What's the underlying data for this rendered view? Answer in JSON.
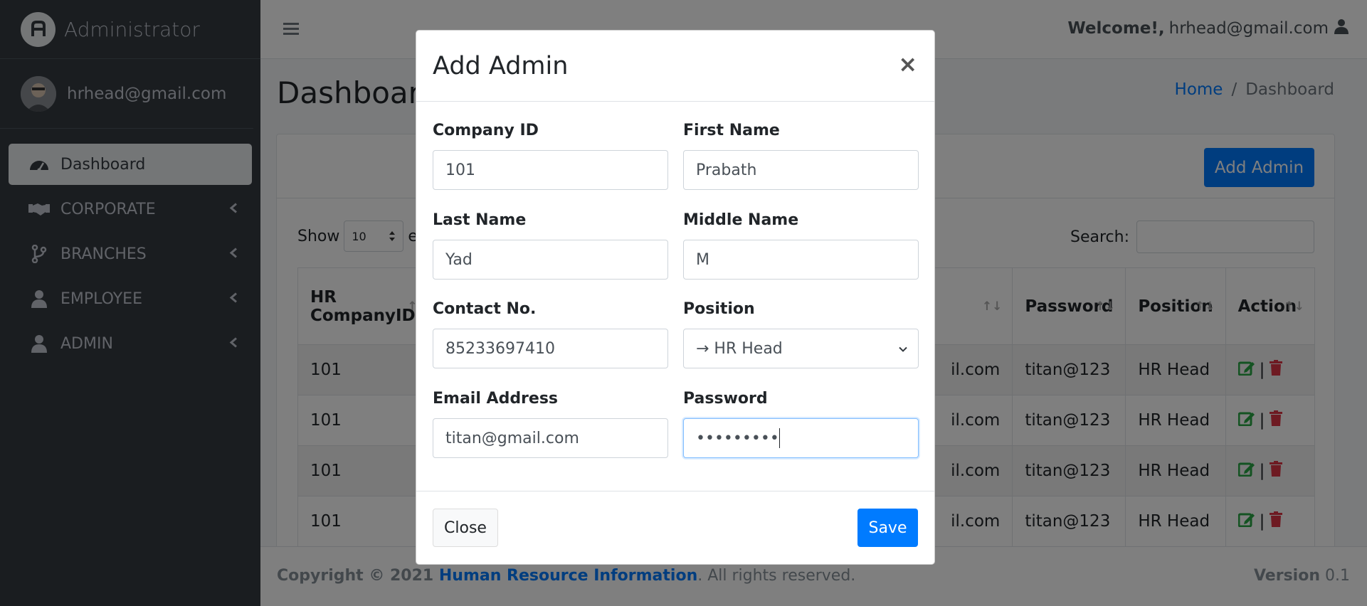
{
  "sidebar": {
    "brand": "Administrator",
    "user": "hrhead@gmail.com",
    "items": [
      {
        "label": "Dashboard",
        "icon": "tachometer-icon",
        "active": true
      },
      {
        "label": "CORPORATE",
        "icon": "handshake-icon"
      },
      {
        "label": "BRANCHES",
        "icon": "code-branch-icon"
      },
      {
        "label": "EMPLOYEE",
        "icon": "user-icon"
      },
      {
        "label": "ADMIN",
        "icon": "user-icon"
      }
    ]
  },
  "navbar": {
    "welcome_bold": "Welcome!,",
    "welcome_email": "hrhead@gmail.com"
  },
  "page": {
    "title": "Dashboard",
    "breadcrumb_home": "Home",
    "breadcrumb_sep": "/",
    "breadcrumb_current": "Dashboard"
  },
  "card": {
    "add_admin_label": "Add Admin",
    "show_label": "Show",
    "show_value": "10",
    "entries_partial": "e",
    "search_label": "Search:"
  },
  "table": {
    "headers": {
      "company_line1": "HR",
      "company_line2": "CompanyID",
      "password": "Password",
      "position": "Position",
      "action": "Action"
    },
    "rows": [
      {
        "company": "101",
        "email_partial": "il.com",
        "password": "titan@123",
        "position": "HR Head"
      },
      {
        "company": "101",
        "email_partial": "il.com",
        "password": "titan@123",
        "position": "HR Head"
      },
      {
        "company": "101",
        "email_partial": "il.com",
        "password": "titan@123",
        "position": "HR Head"
      },
      {
        "company": "101",
        "email_partial": "il.com",
        "password": "titan@123",
        "position": "HR Head"
      }
    ]
  },
  "footer": {
    "copyright": "Copyright © 2021 ",
    "brand": "Human Resource Information",
    "rights": ". All rights reserved.",
    "version_label": "Version",
    "version_value": "0.1"
  },
  "modal": {
    "title": "Add Admin",
    "close_x": "×",
    "fields": {
      "company_id": {
        "label": "Company ID",
        "value": "101"
      },
      "first_name": {
        "label": "First Name",
        "value": "Prabath"
      },
      "last_name": {
        "label": "Last Name",
        "value": "Yad"
      },
      "middle_name": {
        "label": "Middle Name",
        "value": "M"
      },
      "contact": {
        "label": "Contact No.",
        "value": "85233697410"
      },
      "position": {
        "label": "Position",
        "value": "→ HR Head"
      },
      "email": {
        "label": "Email Address",
        "value": "titan@gmail.com"
      },
      "password": {
        "label": "Password",
        "value": "•••••••••"
      }
    },
    "close_button": "Close",
    "save_button": "Save"
  },
  "colors": {
    "primary": "#007bff",
    "sidebar_bg": "#343a40",
    "edit_icon": "#28a745",
    "delete_icon": "#dc3545"
  }
}
